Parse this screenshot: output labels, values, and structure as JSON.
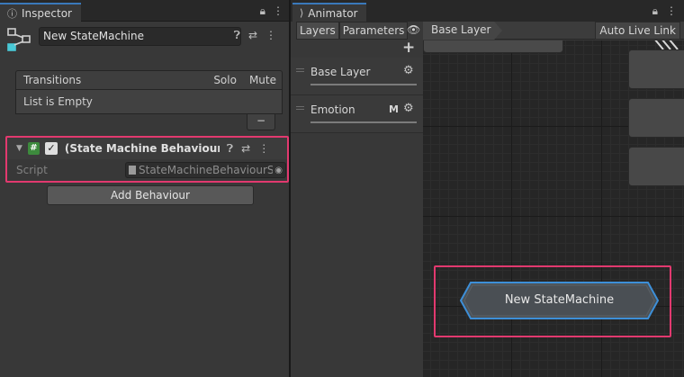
{
  "inspector": {
    "tab_label": "Inspector",
    "tab_icon": "info-icon",
    "name_value": "New StateMachine",
    "transitions": {
      "title": "Transitions",
      "solo": "Solo",
      "mute": "Mute",
      "empty_text": "List is Empty",
      "remove_label": "−"
    },
    "behaviour": {
      "title": "(State Machine Behaviour Sar",
      "script_label": "Script",
      "script_value": "StateMachineBehaviourS"
    },
    "add_behaviour_label": "Add Behaviour"
  },
  "animator": {
    "tab_label": "Animator",
    "subtabs": [
      "Layers",
      "Parameters"
    ],
    "breadcrumb": "Base Layer",
    "auto_live_link": "Auto Live Link",
    "layers": [
      {
        "name": "Base Layer",
        "badge": ""
      },
      {
        "name": "Emotion",
        "badge": "M"
      }
    ],
    "state_machine_node": "New StateMachine"
  },
  "colors": {
    "highlight": "#e2396f",
    "tab_accent": "#3a79bb",
    "node_glow": "#3d8fd8"
  }
}
